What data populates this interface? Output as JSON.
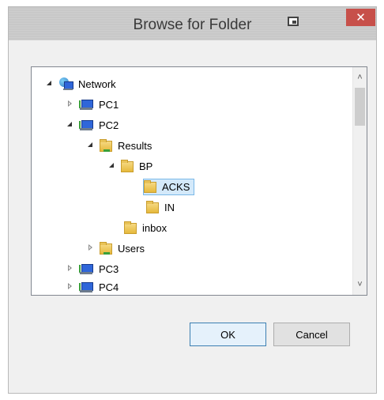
{
  "window": {
    "title": "Browse for Folder",
    "close_glyph": "✕"
  },
  "tree": {
    "items": [
      {
        "label": "Network",
        "depth": 0,
        "expander": "open",
        "icon": "network-icon"
      },
      {
        "label": "PC1",
        "depth": 1,
        "expander": "closed",
        "icon": "computer-icon"
      },
      {
        "label": "PC2",
        "depth": 1,
        "expander": "open",
        "icon": "computer-icon"
      },
      {
        "label": "Results",
        "depth": 2,
        "expander": "open",
        "icon": "shared-folder-icon"
      },
      {
        "label": "BP",
        "depth": 3,
        "expander": "open",
        "icon": "folder-icon"
      },
      {
        "label": "ACKS",
        "depth": 4,
        "expander": "none",
        "icon": "folder-icon",
        "selected": true
      },
      {
        "label": "IN",
        "depth": 4,
        "expander": "none",
        "icon": "folder-icon"
      },
      {
        "label": "inbox",
        "depth": 3,
        "expander": "none",
        "icon": "folder-icon"
      },
      {
        "label": "Users",
        "depth": 2,
        "expander": "closed",
        "icon": "shared-folder-icon"
      },
      {
        "label": "PC3",
        "depth": 1,
        "expander": "closed",
        "icon": "computer-icon"
      },
      {
        "label": "PC4",
        "depth": 1,
        "expander": "closed",
        "icon": "computer-icon"
      }
    ]
  },
  "buttons": {
    "ok": "OK",
    "cancel": "Cancel"
  },
  "colors": {
    "close_button": "#c7504a",
    "selection_fill": "#d4e9fa",
    "selection_border": "#7ab8e8"
  }
}
